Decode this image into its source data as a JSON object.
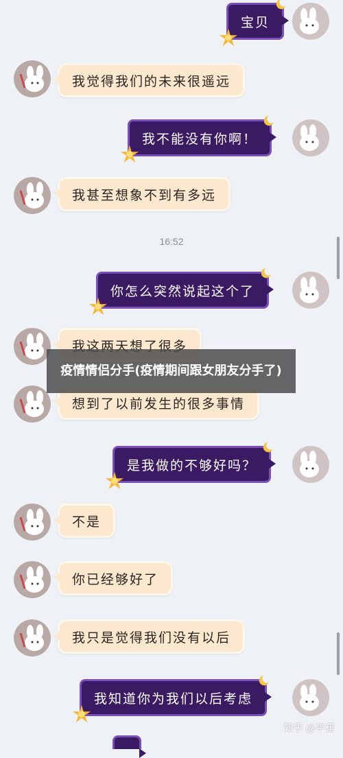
{
  "messages": [
    {
      "side": "sent",
      "text": "宝贝"
    },
    {
      "side": "recv",
      "text": "我觉得我们的未来很遥远"
    },
    {
      "side": "sent",
      "text": "我不能没有你啊！"
    },
    {
      "side": "recv",
      "text": "我甚至想象不到有多远"
    },
    {
      "side": "sent",
      "text": "你怎么突然说起这个了"
    },
    {
      "side": "recv",
      "text": "我这两天想了很多"
    },
    {
      "side": "recv",
      "text": "想到了以前发生的很多事情"
    },
    {
      "side": "sent",
      "text": "是我做的不够好吗？"
    },
    {
      "side": "recv",
      "text": "不是"
    },
    {
      "side": "recv",
      "text": "你已经够好了"
    },
    {
      "side": "recv",
      "text": "我只是觉得我们没有以后"
    },
    {
      "side": "sent",
      "text": "我知道你为我们以后考虑"
    }
  ],
  "timestamp": "16:52",
  "overlay_title": "疫情情侣分手(疫情期间跟女朋友分手了)",
  "watermark": "知乎 @平萑",
  "colors": {
    "background": "#eef2f7",
    "sent_bubble": "#3a1a62",
    "sent_border": "#7c4fb8",
    "recv_bubble": "#fce8cf"
  }
}
